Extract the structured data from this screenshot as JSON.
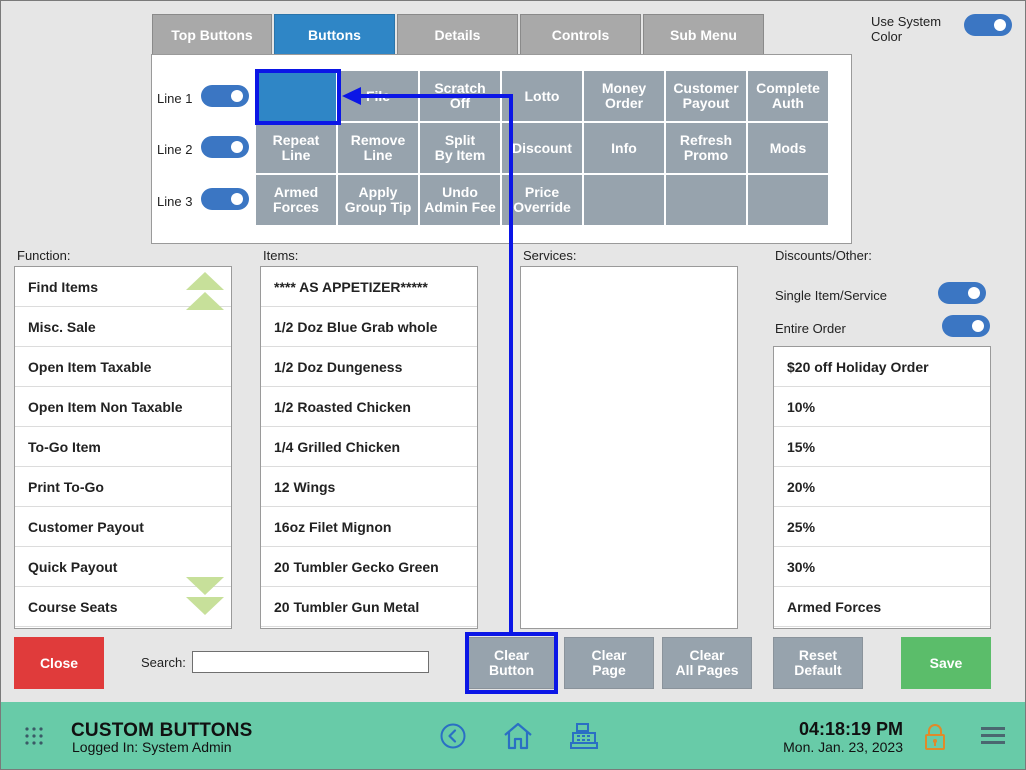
{
  "tabs": [
    {
      "label": "Top Buttons",
      "active": false
    },
    {
      "label": "Buttons",
      "active": true
    },
    {
      "label": "Details",
      "active": false
    },
    {
      "label": "Controls",
      "active": false
    },
    {
      "label": "Sub Menu",
      "active": false
    }
  ],
  "system_color": {
    "label": "Use System Color",
    "checked": true
  },
  "lines": [
    {
      "label": "Line 1",
      "checked": true
    },
    {
      "label": "Line 2",
      "checked": true
    },
    {
      "label": "Line 3",
      "checked": true
    }
  ],
  "grid": [
    [
      "",
      "File",
      "Scratch\nOff",
      "Lotto",
      "Money\nOrder",
      "Customer\nPayout",
      "Complete\nAuth"
    ],
    [
      "Repeat\nLine",
      "Remove\nLine",
      "Split\nBy Item",
      "Discount",
      "Info",
      "Refresh\nPromo",
      "Mods"
    ],
    [
      "Armed\nForces",
      "Apply\nGroup Tip",
      "Undo\nAdmin Fee",
      "Price\nOverride",
      "",
      "",
      ""
    ]
  ],
  "function": {
    "label": "Function:",
    "items": [
      "Find Items",
      "Misc. Sale",
      "Open Item Taxable",
      "Open Item Non Taxable",
      "To-Go Item",
      "Print To-Go",
      "Customer Payout",
      "Quick Payout",
      "Course Seats"
    ]
  },
  "items": {
    "label": "Items:",
    "items": [
      "**** AS APPETIZER*****",
      "1/2 Doz Blue Grab whole",
      "1/2 Doz Dungeness",
      "1/2 Roasted Chicken",
      "1/4 Grilled Chicken",
      "12 Wings",
      "16oz Filet Mignon",
      "20 Tumbler Gecko Green",
      "20 Tumbler Gun Metal"
    ]
  },
  "services": {
    "label": "Services:",
    "items": []
  },
  "discounts": {
    "label": "Discounts/Other:",
    "single_item": {
      "label": "Single Item/Service",
      "checked": true
    },
    "entire_order": {
      "label": "Entire Order",
      "checked": true
    },
    "items": [
      "$20 off Holiday Order",
      "10%",
      "15%",
      "20%",
      "25%",
      "30%",
      "Armed Forces"
    ]
  },
  "buttons": {
    "close": "Close",
    "search_label": "Search:",
    "search_value": "",
    "clear_button": "Clear\nButton",
    "clear_page": "Clear\nPage",
    "clear_all_pages": "Clear\nAll Pages",
    "reset_default": "Reset\nDefault",
    "save": "Save"
  },
  "footer": {
    "title": "CUSTOM BUTTONS",
    "logged_in": "Logged In:  System Admin",
    "time": "04:18:19 PM",
    "date": "Mon. Jan. 23, 2023"
  },
  "colors": {
    "accent": "#2f86c6",
    "toggle": "#3b76c3",
    "footer": "#68cba8",
    "close": "#e03b3b",
    "save": "#5bbd6a",
    "annotation": "#0b16e6"
  },
  "icons": [
    "apps-grid-icon",
    "back-circle-icon",
    "home-icon",
    "register-icon",
    "lock-icon",
    "hamburger-menu-icon"
  ]
}
